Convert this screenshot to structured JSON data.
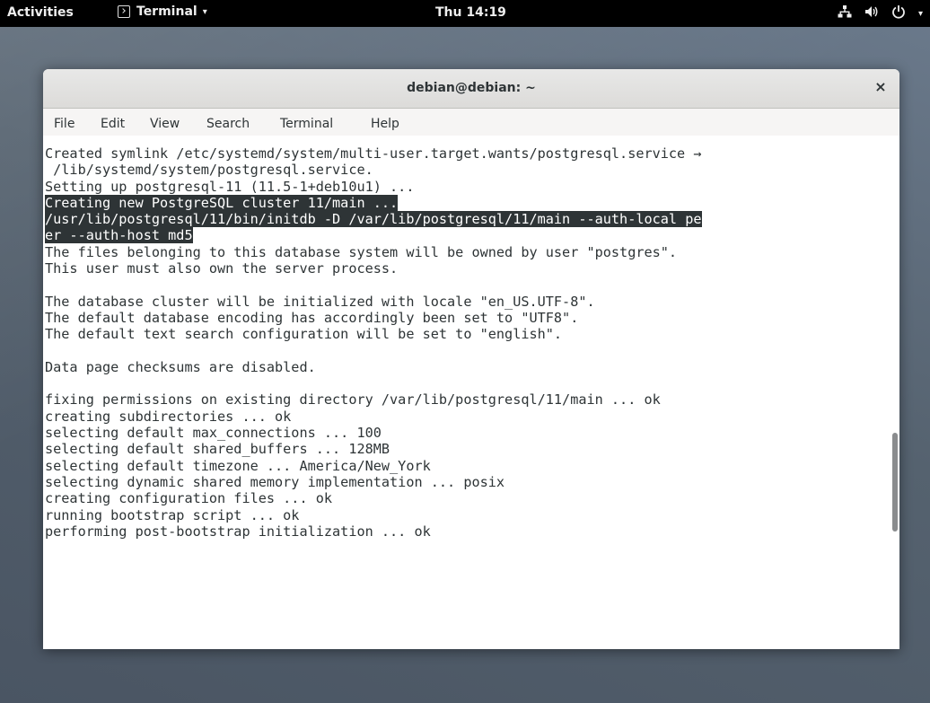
{
  "topbar": {
    "activities": "Activities",
    "app_name": "Terminal",
    "app_caret": "▾",
    "clock": "Thu 14:19",
    "network_icon": "network-icon",
    "volume_icon": "volume-icon",
    "power_icon": "power-icon",
    "menu_caret": "▾"
  },
  "window": {
    "title": "debian@debian: ~",
    "close_glyph": "×"
  },
  "menubar": {
    "items": [
      "File",
      "Edit",
      "View",
      "Search",
      "Terminal",
      "Help"
    ]
  },
  "terminal": {
    "lines": [
      "Created symlink /etc/systemd/system/multi-user.target.wants/postgresql.service →",
      " /lib/systemd/system/postgresql.service.",
      "Setting up postgresql-11 (11.5-1+deb10u1) ...",
      "Creating new PostgreSQL cluster 11/main ...",
      "/usr/lib/postgresql/11/bin/initdb -D /var/lib/postgresql/11/main --auth-local pe",
      "er --auth-host md5",
      "The files belonging to this database system will be owned by user \"postgres\".",
      "This user must also own the server process.",
      "",
      "The database cluster will be initialized with locale \"en_US.UTF-8\".",
      "The default database encoding has accordingly been set to \"UTF8\".",
      "The default text search configuration will be set to \"english\".",
      "",
      "Data page checksums are disabled.",
      "",
      "fixing permissions on existing directory /var/lib/postgresql/11/main ... ok",
      "creating subdirectories ... ok",
      "selecting default max_connections ... 100",
      "selecting default shared_buffers ... 128MB",
      "selecting default timezone ... America/New_York",
      "selecting dynamic shared memory implementation ... posix",
      "creating configuration files ... ok",
      "running bootstrap script ... ok",
      "performing post-bootstrap initialization ... ok"
    ],
    "selected_lines": [
      3,
      4,
      5
    ]
  },
  "colors": {
    "topbar_bg": "#000000",
    "selection_bg": "#2e3436",
    "text": "#2e3436"
  }
}
